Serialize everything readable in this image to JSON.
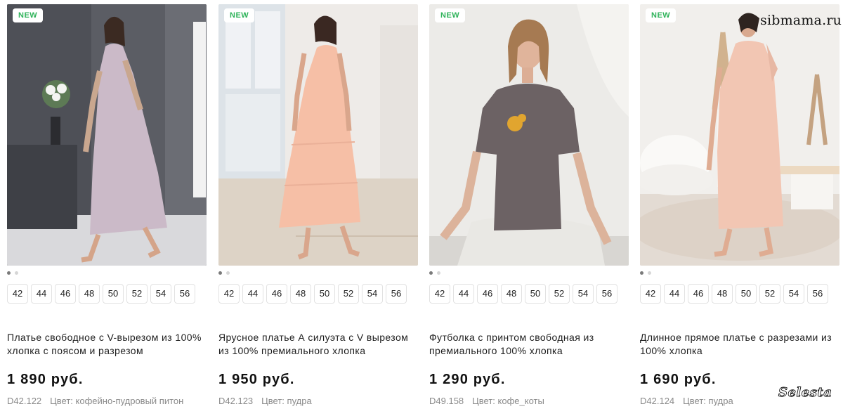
{
  "badge_label": "NEW",
  "sizes": [
    "42",
    "44",
    "46",
    "48",
    "50",
    "52",
    "54",
    "56"
  ],
  "color_prefix": "Цвет:",
  "products": [
    {
      "title": "Платье свободное с V-вырезом из 100% хлопка с поясом и разрезом",
      "price": "1 890 руб.",
      "sku": "D42.122",
      "color": "кофейно-пудровый питон",
      "image": "woman-in-python-print-dress"
    },
    {
      "title": "Ярусное платье А силуэта с V вырезом из 100% премиального хлопка",
      "price": "1 950 руб.",
      "sku": "D42.123",
      "color": "пудра",
      "image": "woman-in-peach-tiered-dress"
    },
    {
      "title": "Футболка с принтом свободная из премиального 100% хлопка",
      "price": "1 290 руб.",
      "sku": "D49.158",
      "color": "кофе_коты",
      "image": "woman-in-grey-cat-print-tshirt"
    },
    {
      "title": "Длинное прямое платье с разрезами из 100% хлопка",
      "price": "1 690 руб.",
      "sku": "D42.124",
      "color": "пудра",
      "image": "woman-in-long-pink-dress"
    }
  ],
  "watermark_site": "sibmama.ru",
  "watermark_logo": "Selesta",
  "colors": {
    "badge_text": "#2fb35a",
    "price": "#111111",
    "meta": "#8a8a8a"
  }
}
